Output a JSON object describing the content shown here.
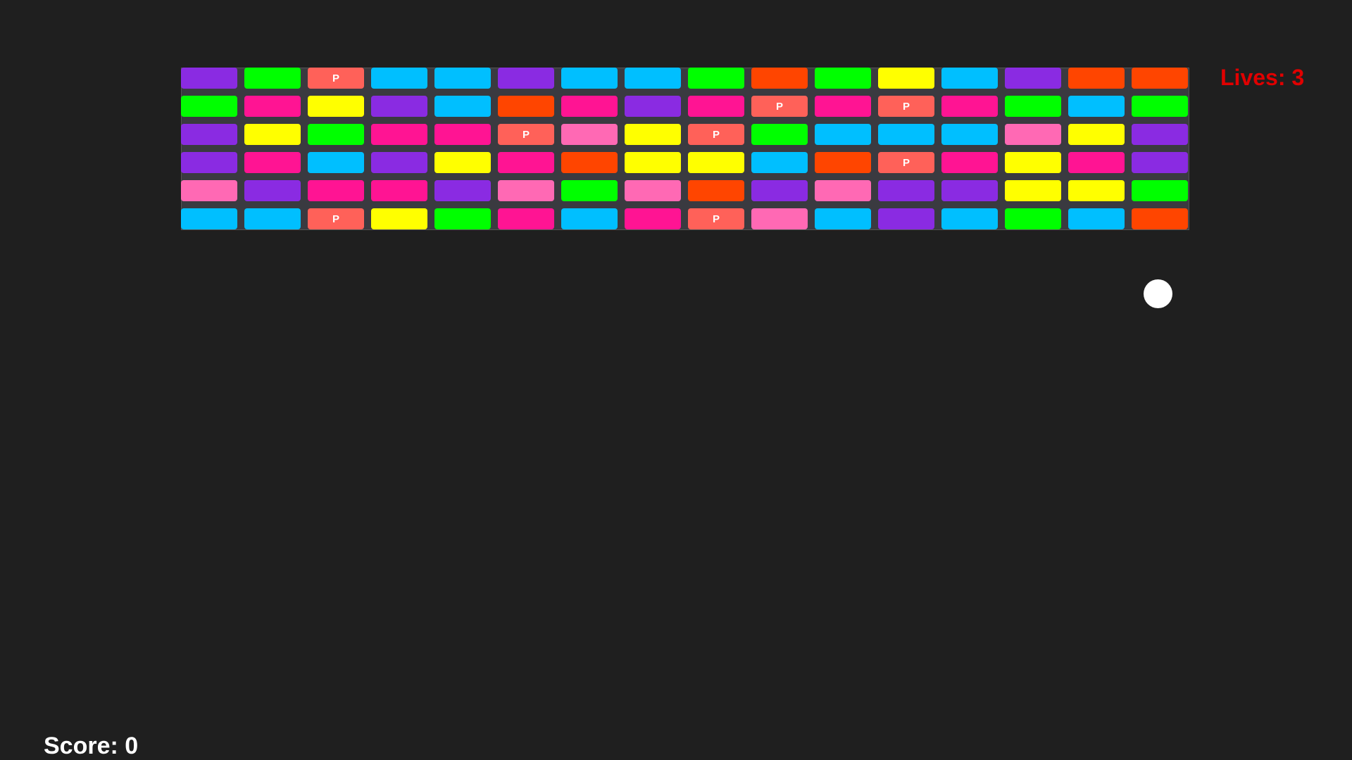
{
  "hud": {
    "lives_text": "Lives: 3",
    "score_text": "Score: 0",
    "lives_color": "#e00000",
    "score_color": "#ffffff"
  },
  "palette": {
    "purple": "#8a2be2",
    "green": "#00ff00",
    "coral": "#ff6159",
    "cyan": "#00bfff",
    "orange": "#ff4500",
    "magenta": "#ff1493",
    "yellow": "#ffff00",
    "pink": "#ff69b4"
  },
  "powerup_label": "P",
  "bricks": [
    [
      "purple",
      "green",
      "coral:P",
      "cyan",
      "cyan",
      "purple",
      "cyan",
      "cyan",
      "green",
      "orange",
      "green",
      "yellow",
      "cyan",
      "purple",
      "orange",
      "orange"
    ],
    [
      "green",
      "magenta",
      "yellow",
      "purple",
      "cyan",
      "orange",
      "magenta",
      "purple",
      "magenta",
      "coral:P",
      "magenta",
      "coral:P",
      "magenta",
      "green",
      "cyan",
      "green"
    ],
    [
      "purple",
      "yellow",
      "green",
      "magenta",
      "magenta",
      "coral:P",
      "pink",
      "yellow",
      "coral:P",
      "green",
      "cyan",
      "cyan",
      "cyan",
      "pink",
      "yellow",
      "purple"
    ],
    [
      "purple",
      "magenta",
      "cyan",
      "purple",
      "yellow",
      "magenta",
      "orange",
      "yellow",
      "yellow",
      "cyan",
      "orange",
      "coral:P",
      "magenta",
      "yellow",
      "magenta",
      "purple"
    ],
    [
      "pink",
      "purple",
      "magenta",
      "magenta",
      "purple",
      "pink",
      "green",
      "pink",
      "orange",
      "purple",
      "pink",
      "purple",
      "purple",
      "yellow",
      "yellow",
      "green"
    ],
    [
      "cyan",
      "cyan",
      "coral:P",
      "yellow",
      "green",
      "magenta",
      "cyan",
      "magenta",
      "coral:P",
      "pink",
      "cyan",
      "purple",
      "cyan",
      "green",
      "cyan",
      "orange"
    ]
  ],
  "ball_color": "#ffffff"
}
